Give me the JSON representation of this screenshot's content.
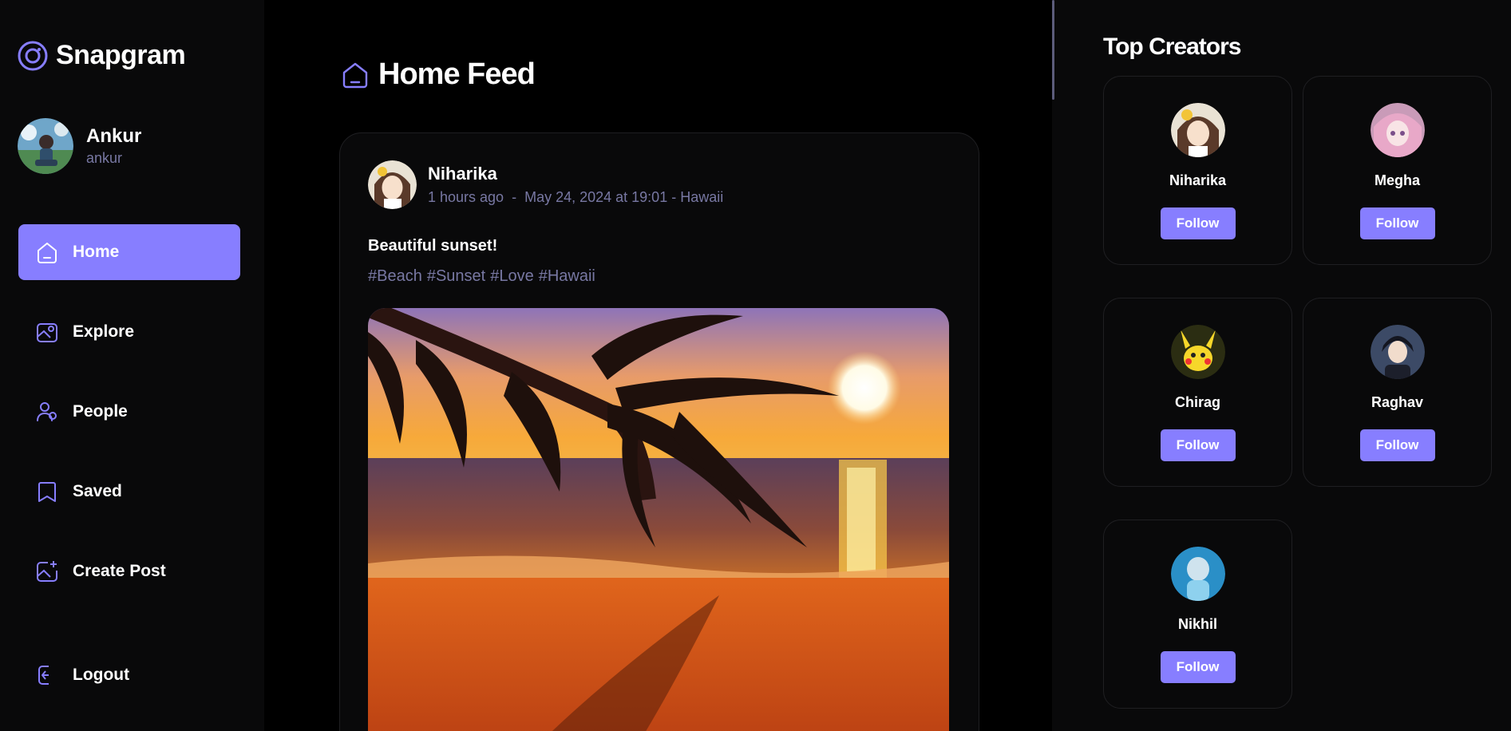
{
  "app": {
    "name": "Snapgram",
    "accent_color": "#877eff",
    "muted_text_color": "#7878a3"
  },
  "user": {
    "name": "Ankur",
    "handle": "ankur"
  },
  "sidebar": {
    "items": [
      {
        "label": "Home",
        "icon": "home-icon",
        "active": true
      },
      {
        "label": "Explore",
        "icon": "explore-icon",
        "active": false
      },
      {
        "label": "People",
        "icon": "people-icon",
        "active": false
      },
      {
        "label": "Saved",
        "icon": "bookmark-icon",
        "active": false
      },
      {
        "label": "Create Post",
        "icon": "create-post-icon",
        "active": false
      }
    ],
    "logout_label": "Logout"
  },
  "main": {
    "title": "Home Feed",
    "post": {
      "author": "Niharika",
      "time_ago": "1 hours ago",
      "separator": "-",
      "date_location": "May 24, 2024 at 19:01 - Hawaii",
      "caption": "Beautiful sunset!",
      "tags": [
        "#Beach",
        "#Sunset",
        "#Love",
        "#Hawaii"
      ]
    }
  },
  "rightbar": {
    "title": "Top Creators",
    "follow_label": "Follow",
    "creators": [
      {
        "name": "Niharika"
      },
      {
        "name": "Megha"
      },
      {
        "name": "Chirag"
      },
      {
        "name": "Raghav"
      },
      {
        "name": "Nikhil"
      }
    ]
  }
}
